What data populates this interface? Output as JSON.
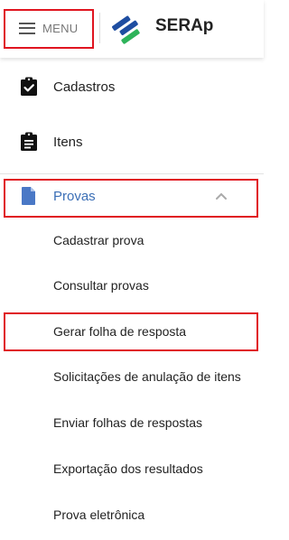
{
  "header": {
    "menu_label": "MENU",
    "brand": "SERAp"
  },
  "nav": {
    "items": [
      {
        "label": "Cadastros",
        "icon": "clipboard-check-icon"
      },
      {
        "label": "Itens",
        "icon": "clipboard-list-icon"
      },
      {
        "label": "Provas",
        "icon": "document-icon",
        "expanded": true
      }
    ],
    "provas_submenu": [
      "Cadastrar prova",
      "Consultar provas",
      "Gerar folha de resposta",
      "Solicitações de anulação de itens",
      "Enviar folhas de respostas",
      "Exportação dos resultados",
      "Prova eletrônica"
    ]
  },
  "colors": {
    "accent_blue": "#3b6fb6",
    "highlight_red": "#e01520",
    "logo_blue": "#1f4ea1",
    "logo_green": "#2eb35a"
  }
}
